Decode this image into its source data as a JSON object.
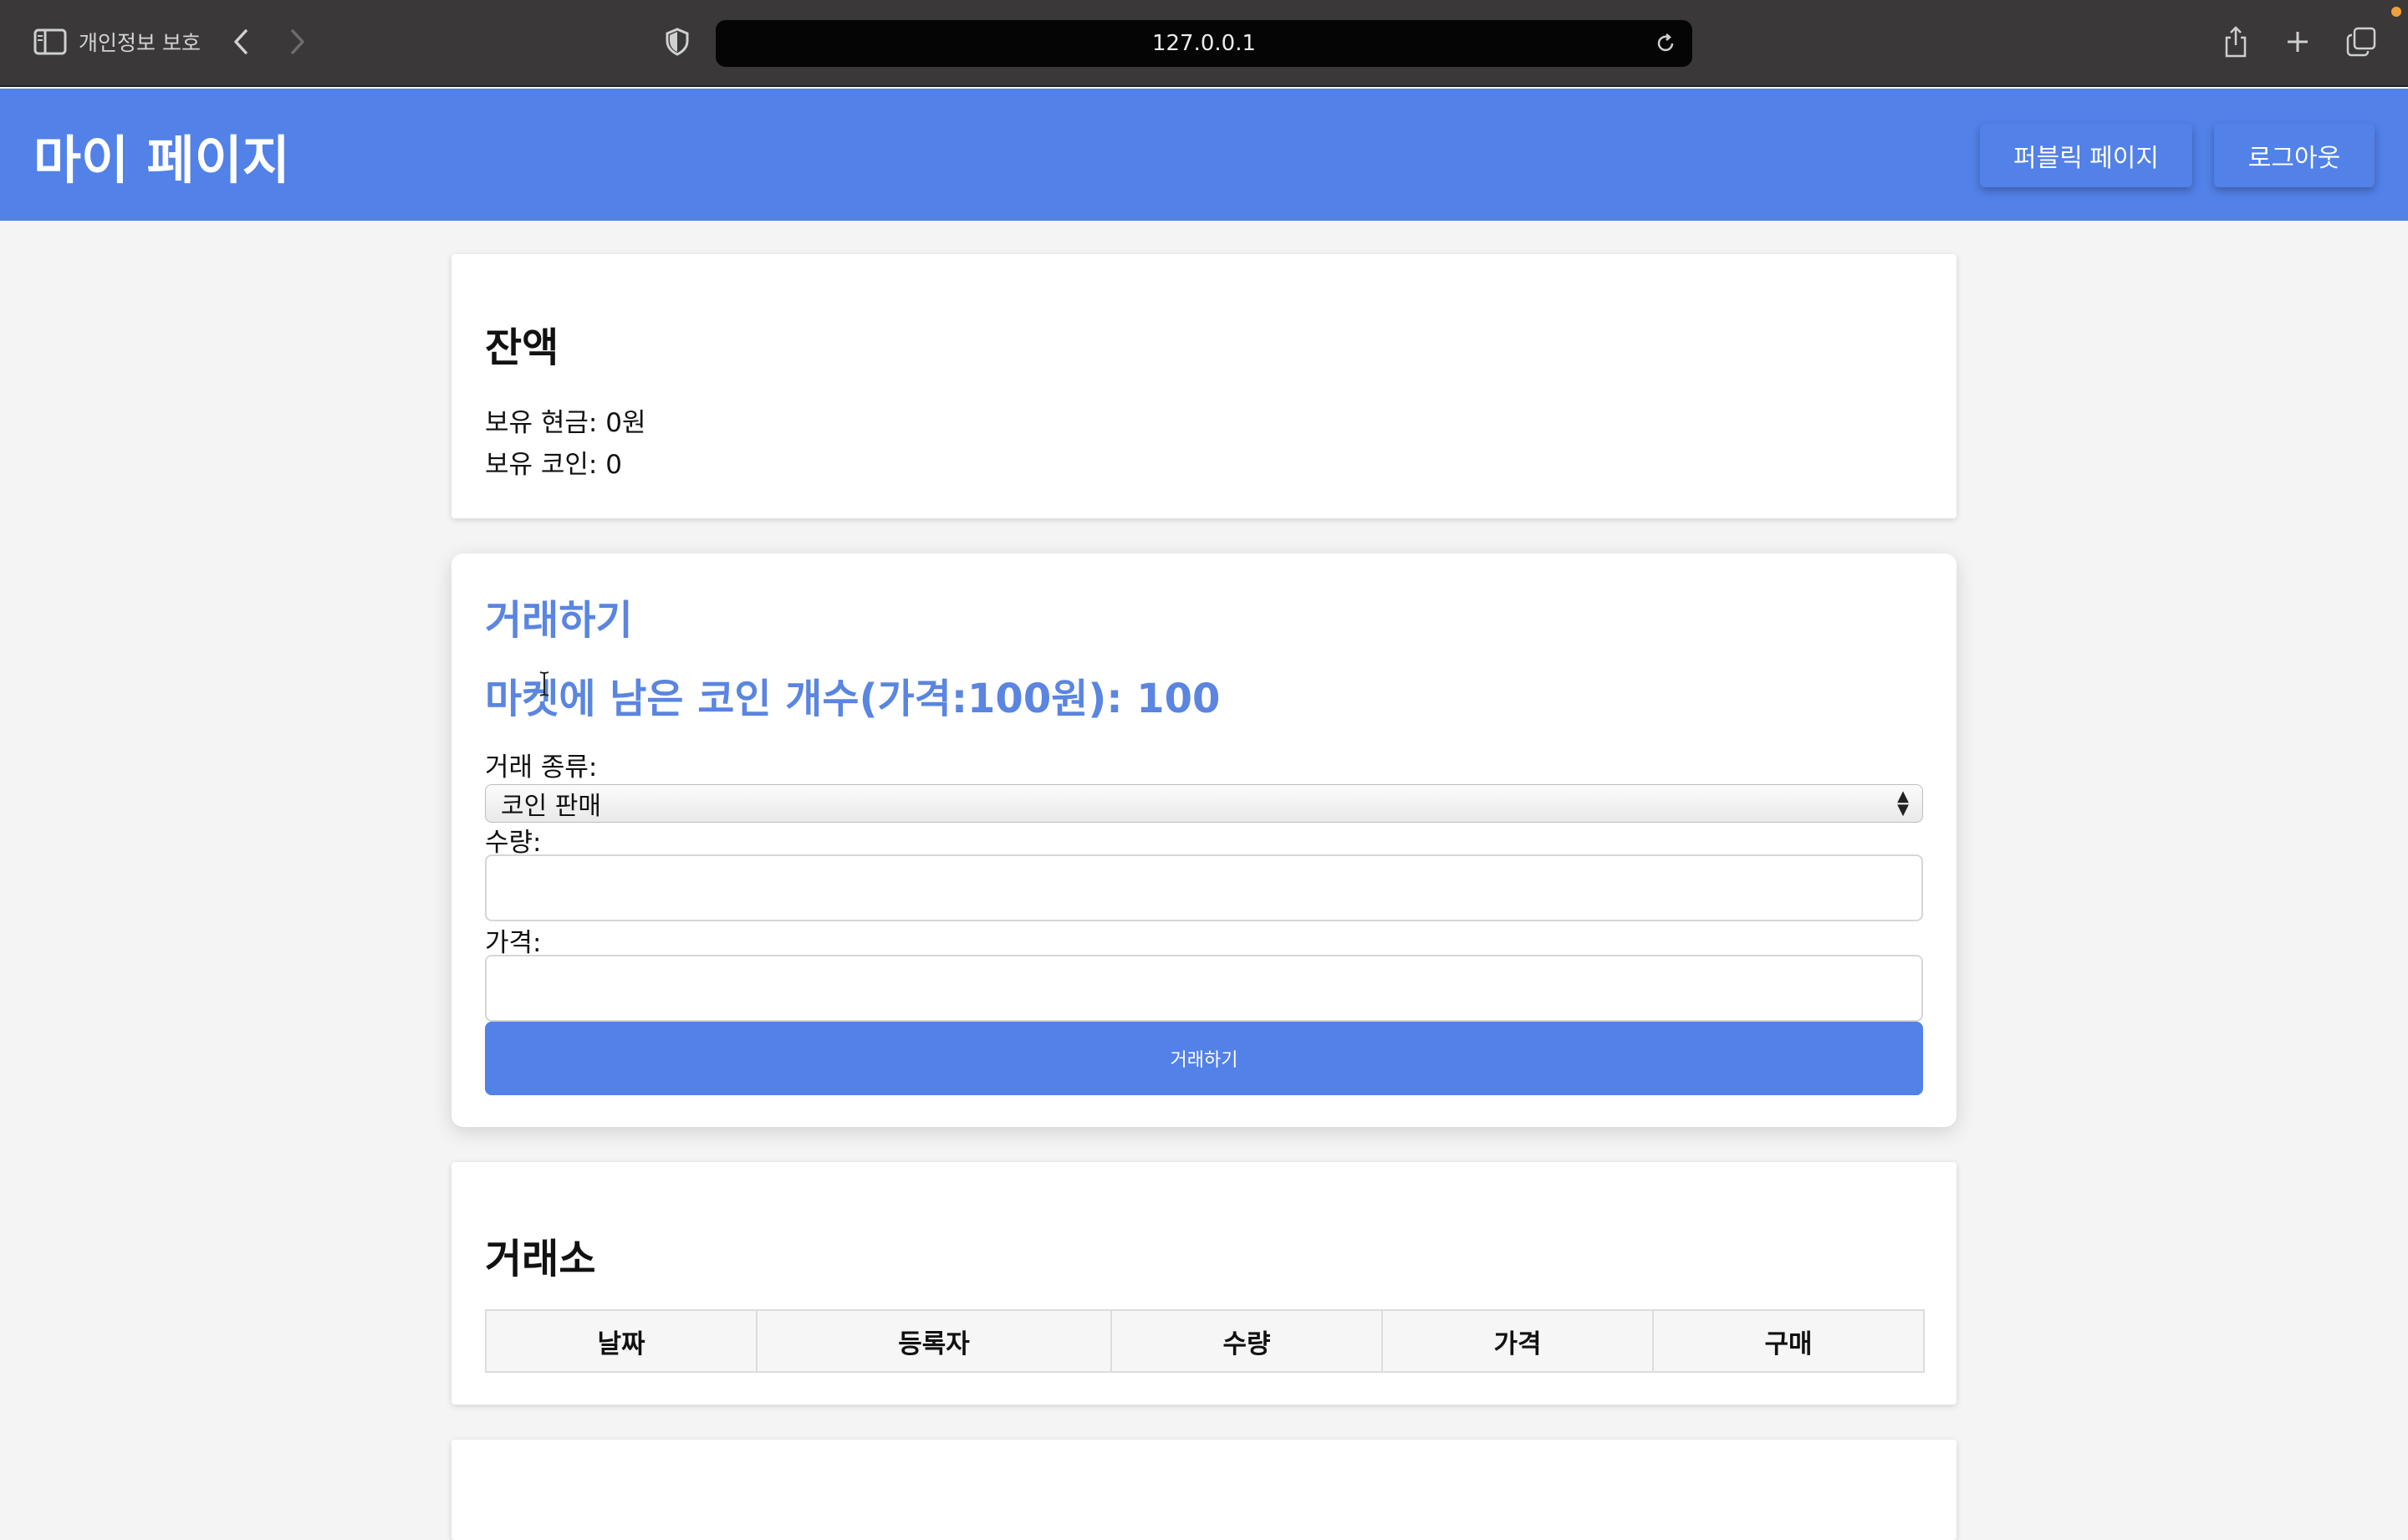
{
  "browser": {
    "privacy_label": "개인정보 보호",
    "url": "127.0.0.1",
    "icons": [
      "sidebar-icon",
      "chevron-left-icon",
      "chevron-right-icon",
      "shield-icon",
      "reload-icon",
      "share-icon",
      "plus-icon",
      "tabs-icon"
    ]
  },
  "header": {
    "title": "마이 페이지",
    "public_page_label": "퍼블릭 페이지",
    "logout_label": "로그아웃",
    "accent_color": "#5281e8"
  },
  "balance": {
    "title": "잔액",
    "cash_line": "보유 현금: 0원",
    "coin_line": "보유 코인: 0"
  },
  "trade": {
    "title": "거래하기",
    "market_remaining": "마켓에 남은 코인 개수(가격:100원): 100",
    "type_label": "거래 종류:",
    "type_selected": "코인 판매",
    "quantity_label": "수량:",
    "quantity_value": "",
    "price_label": "가격:",
    "price_value": "",
    "submit_label": "거래하기"
  },
  "market": {
    "title": "거래소",
    "columns": [
      "날짜",
      "등록자",
      "수량",
      "가격",
      "구매"
    ],
    "rows": []
  }
}
